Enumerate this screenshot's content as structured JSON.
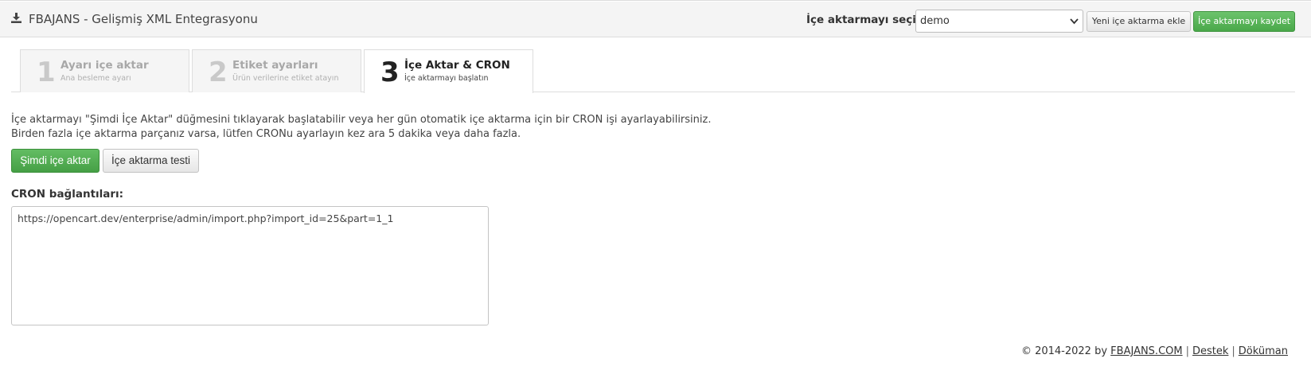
{
  "header": {
    "title": "FBAJANS - Gelişmiş XML Entegrasyonu",
    "icon": "download-icon",
    "select_label": "İçe aktarmayı seçin:",
    "select_value": "demo",
    "new_button": "Yeni içe aktarma ekle",
    "save_button": "İçe aktarmayı kaydet",
    "colors": {
      "header_bg": "#f4f4f4",
      "success": "#4aa84a"
    }
  },
  "tabs": [
    {
      "number": "1",
      "title": "Ayarı içe aktar",
      "subtitle": "Ana besleme ayarı",
      "active": false
    },
    {
      "number": "2",
      "title": "Etiket ayarları",
      "subtitle": "Ürün verilerine etiket atayın",
      "active": false
    },
    {
      "number": "3",
      "title": "İçe Aktar & CRON",
      "subtitle": "İçe aktarmayı başlatın",
      "active": true
    }
  ],
  "main": {
    "description_line1": "İçe aktarmayı \"Şimdi İçe Aktar\" düğmesini tıklayarak başlatabilir veya her gün otomatik içe aktarma için bir CRON işi ayarlayabilirsiniz.",
    "description_line2": "Birden fazla içe aktarma parçanız varsa, lütfen CRONu ayarlayın kez ara 5 dakika veya daha fazla.",
    "import_now_button": "Şimdi içe aktar",
    "test_button": "İçe aktarma testi",
    "cron_label": "CRON bağlantıları:",
    "cron_url": "https://opencart.dev/enterprise/admin/import.php?import_id=25&part=1_1"
  },
  "footer": {
    "copyright": "© 2014-2022 by",
    "company_link": "FBAJANS.COM",
    "separator": "|",
    "support_link": "Destek",
    "docs_link": "Döküman"
  }
}
